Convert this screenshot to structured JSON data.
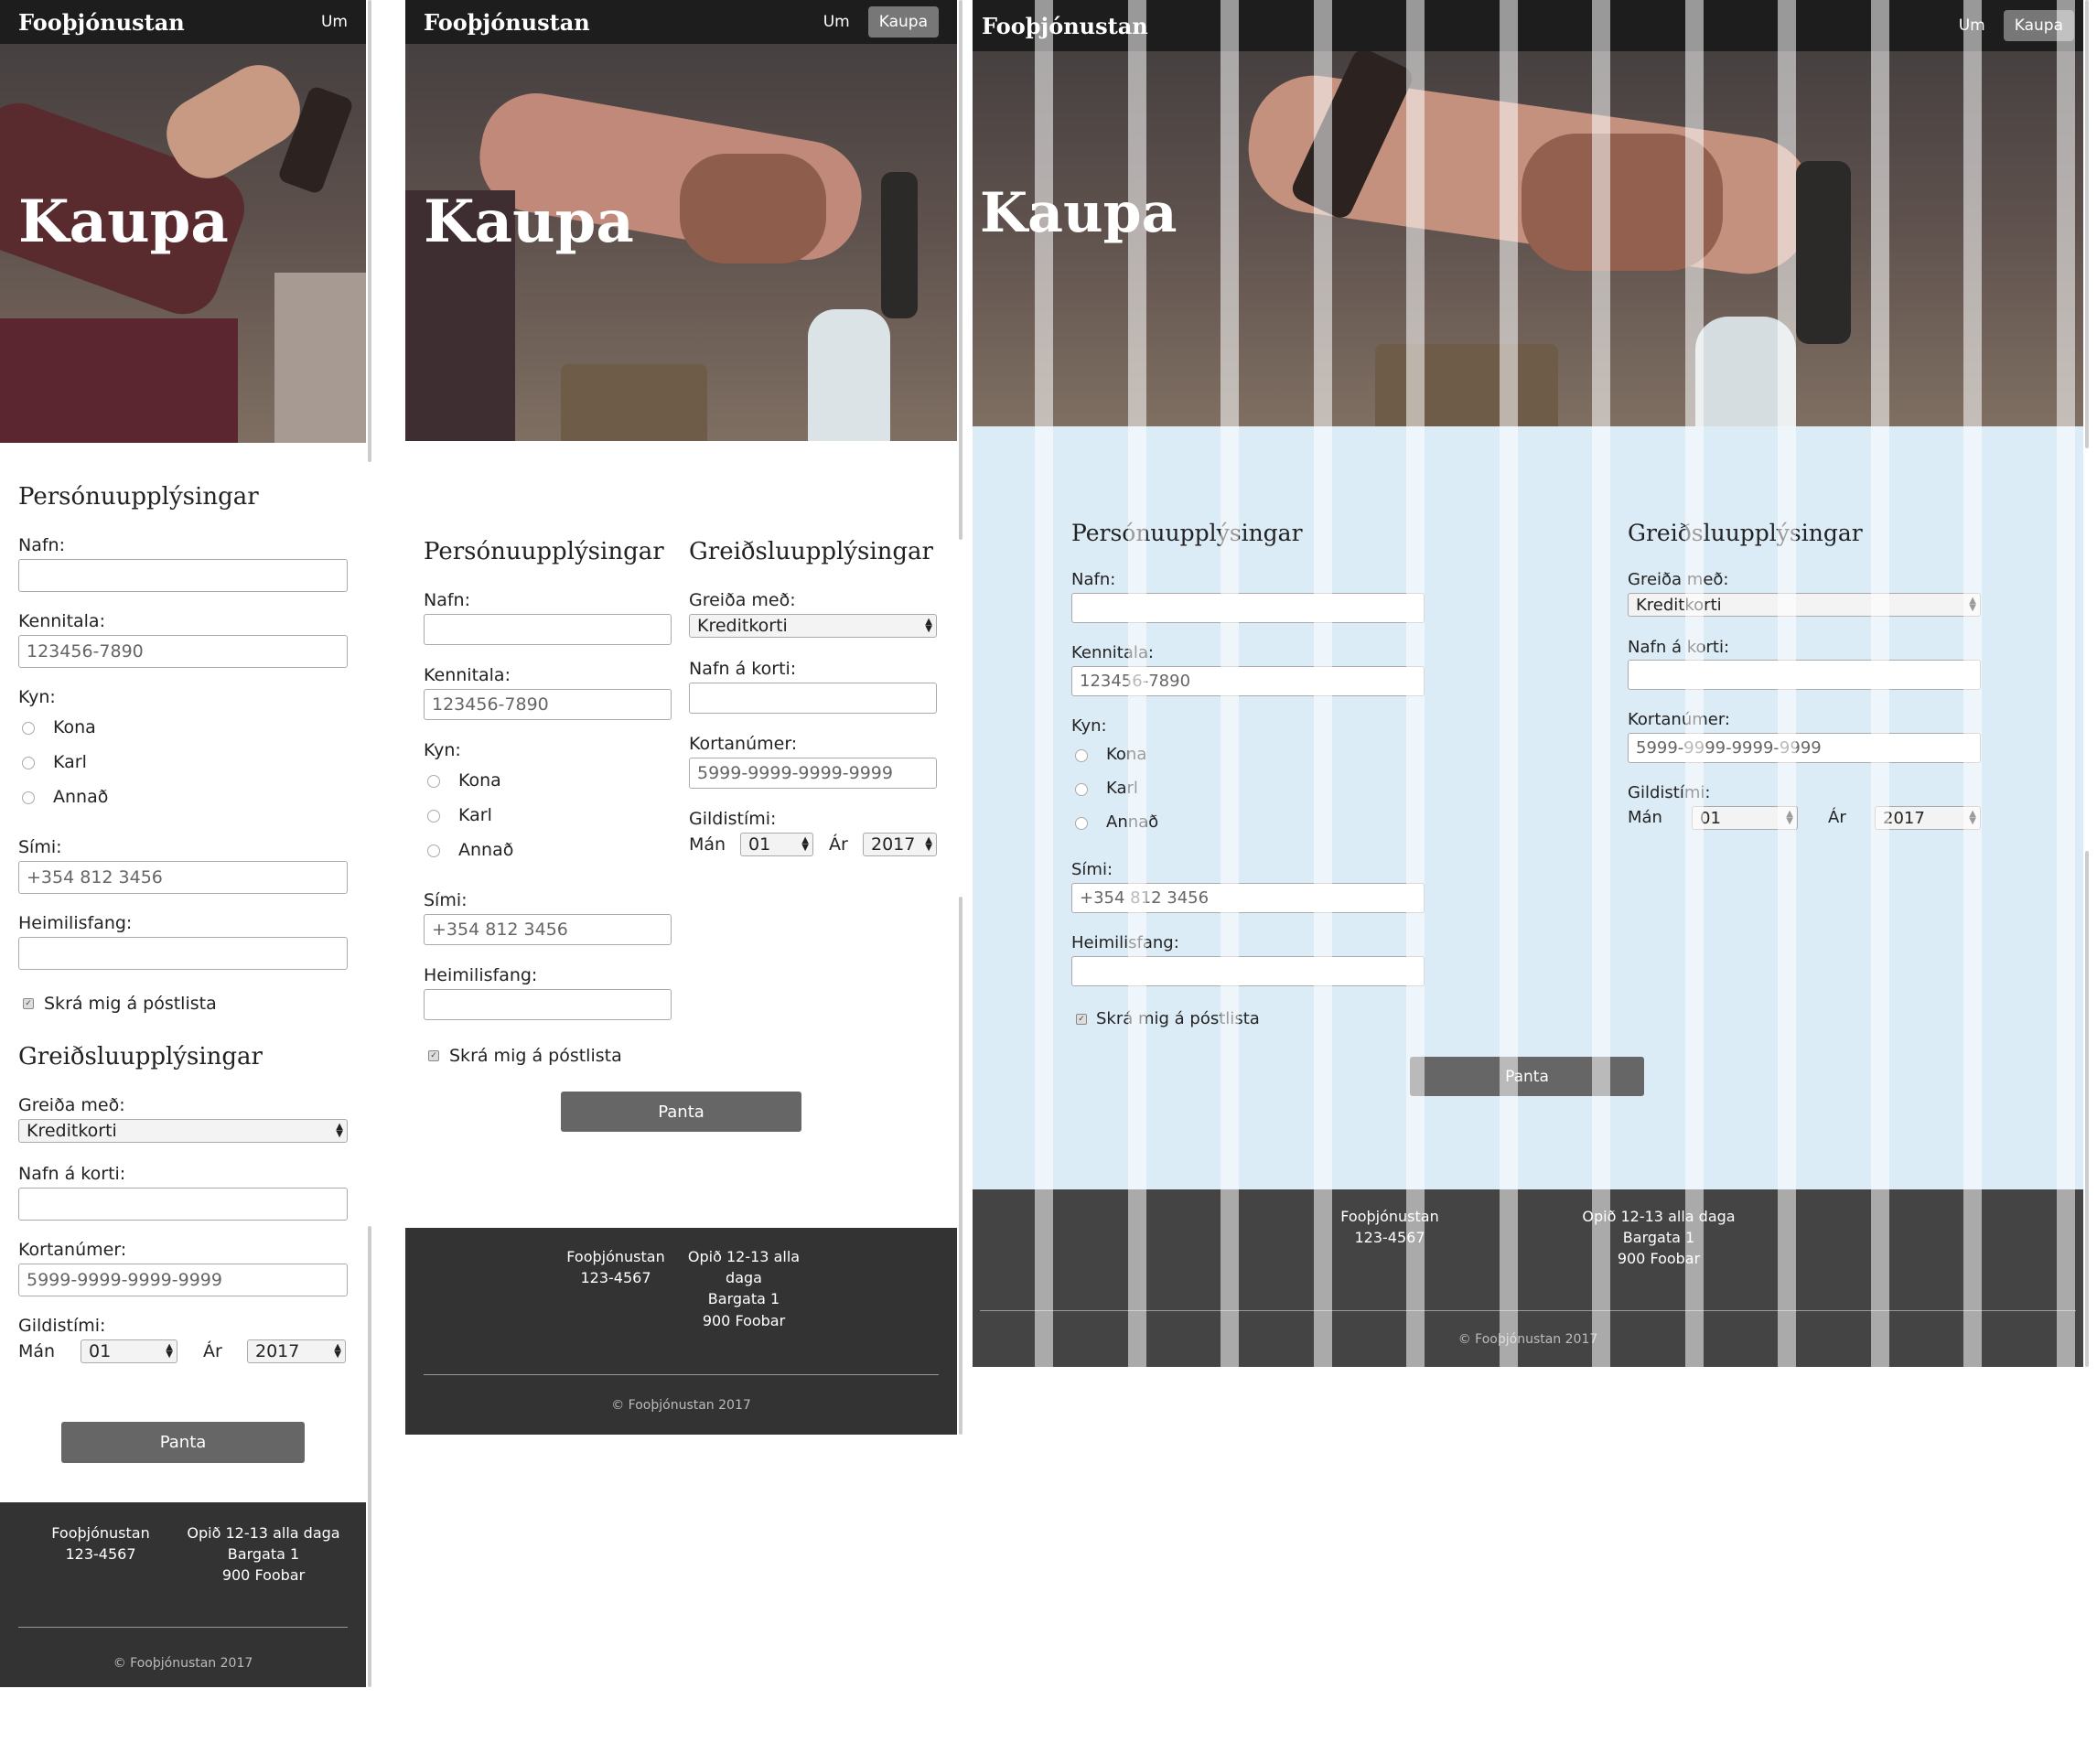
{
  "brand": "Fooþjónustan",
  "nav": {
    "about": "Um",
    "buy": "Kaupa"
  },
  "hero_title": "Kaupa",
  "personal": {
    "title": "Persónuupplýsingar",
    "name_label": "Nafn:",
    "name_value": "",
    "kennitala_label": "Kennitala:",
    "kennitala_placeholder": "123456-7890",
    "gender_label": "Kyn:",
    "gender_options": [
      "Kona",
      "Karl",
      "Annað"
    ],
    "phone_label": "Sími:",
    "phone_placeholder": "+354 812 3456",
    "address_label": "Heimilisfang:",
    "address_value": "",
    "newsletter_label": "Skrá mig á póstlista",
    "newsletter_checked": true
  },
  "payment": {
    "title": "Greiðsluupplýsingar",
    "method_label": "Greiða með:",
    "method_value": "Kreditkorti",
    "cardname_label": "Nafn á korti:",
    "cardname_value": "",
    "cardnumber_label": "Kortanúmer:",
    "cardnumber_placeholder": "5999-9999-9999-9999",
    "expiry_label": "Gildistími:",
    "month_label": "Mán",
    "month_value": "01",
    "year_label": "Ár",
    "year_value": "2017"
  },
  "submit_label": "Panta",
  "footer": {
    "company": "Fooþjónustan",
    "phone": "123-4567",
    "hours": "Opið 12-13 alla daga",
    "hours_line1": "Opið 12-13 alla",
    "hours_line2": "daga",
    "street": "Bargata 1",
    "city": "900 Foobar",
    "copyright": "© Fooþjónustan 2017"
  },
  "colors": {
    "header_bg": "#1d1d1d",
    "button_bg": "#666666",
    "footer_bg": "#333333",
    "grid_overlay_bg": "#dcecf7"
  }
}
